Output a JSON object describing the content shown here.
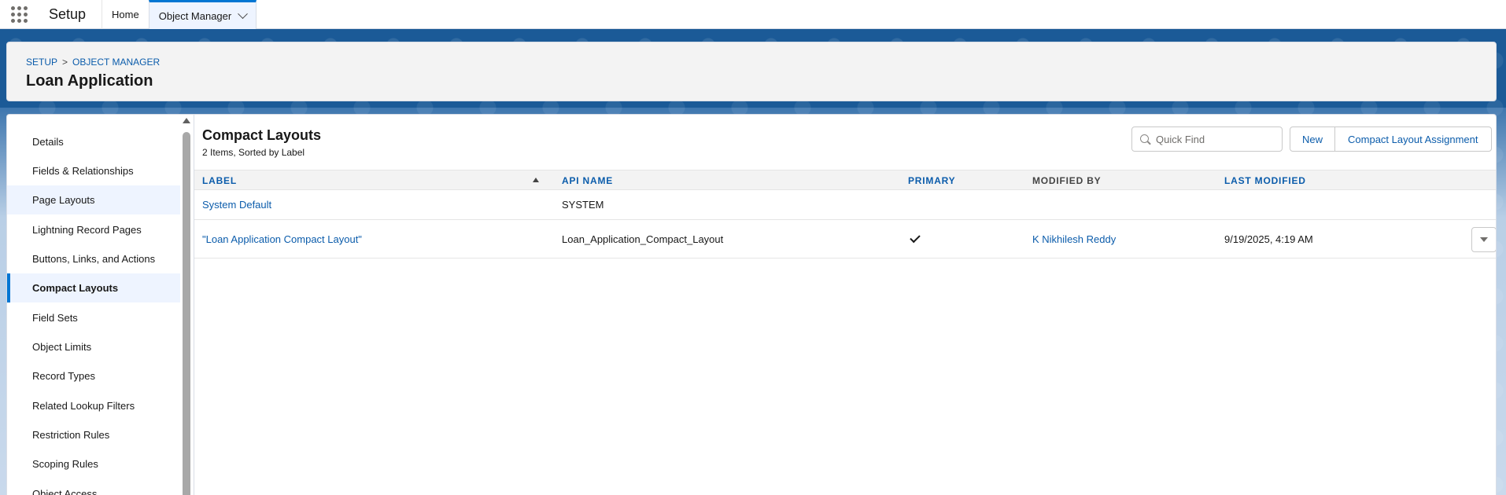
{
  "topnav": {
    "app_name": "Setup",
    "tabs": [
      {
        "label": "Home"
      },
      {
        "label": "Object Manager"
      }
    ]
  },
  "header": {
    "breadcrumb": [
      "SETUP",
      ">",
      "OBJECT MANAGER"
    ],
    "title": "Loan Application"
  },
  "sidebar": {
    "items": [
      {
        "label": "Details"
      },
      {
        "label": "Fields & Relationships"
      },
      {
        "label": "Page Layouts"
      },
      {
        "label": "Lightning Record Pages"
      },
      {
        "label": "Buttons, Links, and Actions"
      },
      {
        "label": "Compact Layouts"
      },
      {
        "label": "Field Sets"
      },
      {
        "label": "Object Limits"
      },
      {
        "label": "Record Types"
      },
      {
        "label": "Related Lookup Filters"
      },
      {
        "label": "Restriction Rules"
      },
      {
        "label": "Scoping Rules"
      },
      {
        "label": "Object Access"
      }
    ],
    "selected": "Compact Layouts",
    "hovered": "Page Layouts"
  },
  "main": {
    "title": "Compact Layouts",
    "subtitle": "2 Items, Sorted by Label",
    "quick_find_placeholder": "Quick Find",
    "buttons": {
      "new": "New",
      "assignment": "Compact Layout Assignment"
    },
    "columns": [
      "LABEL",
      "API NAME",
      "PRIMARY",
      "MODIFIED BY",
      "LAST MODIFIED"
    ],
    "rows": [
      {
        "label": "System Default",
        "api_name": "SYSTEM",
        "primary": false,
        "modified_by": "",
        "last_modified": ""
      },
      {
        "label": "\"Loan Application Compact Layout\"",
        "api_name": "Loan_Application_Compact_Layout",
        "primary": true,
        "modified_by": "K Nikhilesh Reddy",
        "last_modified": "9/19/2025, 4:19 AM"
      }
    ]
  },
  "colors": {
    "accent": "#0176d3",
    "link": "#0b5cab",
    "header_bg": "#f3f3f3",
    "brand_bg": "#1b5a97"
  }
}
